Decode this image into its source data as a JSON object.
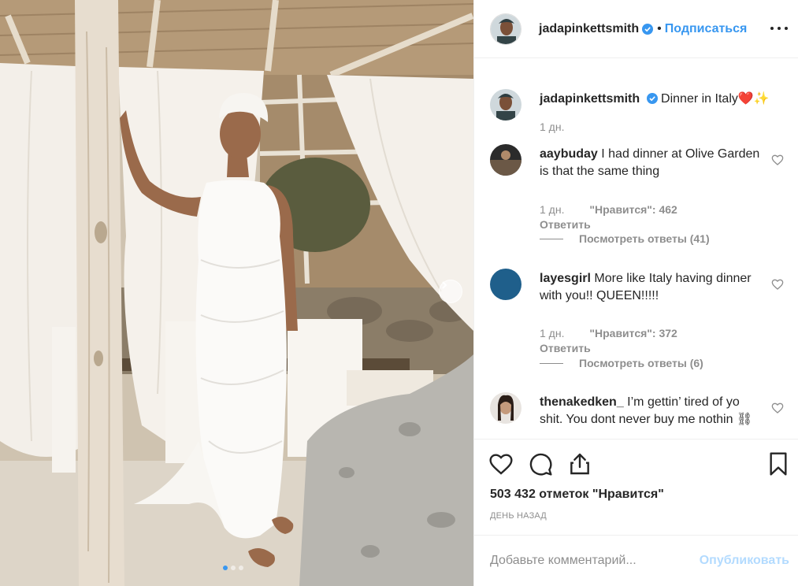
{
  "post": {
    "username": "jadapinkettsmith",
    "follow_label": "Подписаться",
    "more_icon": "more-horizontal-icon",
    "caption": {
      "username": "jadapinkettsmith",
      "text": "Dinner in Italy❤️✨",
      "time": "1 дн."
    },
    "likes_label": "503 432 отметок \"Нравится\"",
    "time_ago": "ДЕНЬ НАЗАД",
    "carousel": {
      "total": 3,
      "active": 1
    }
  },
  "comments": [
    {
      "username": "aaybuday",
      "text": "I had dinner at Olive Garden is that the same thing",
      "time": "1 дн.",
      "likes": "\"Нравится\": 462",
      "reply_label": "Ответить",
      "view_replies": "Посмотреть ответы (41)"
    },
    {
      "username": "layesgirl",
      "text": "More like Italy having dinner with you!! QUEEN!!!!!",
      "time": "1 дн.",
      "likes": "\"Нравится\": 372",
      "reply_label": "Ответить",
      "view_replies": "Посмотреть ответы (6)"
    },
    {
      "username": "thenakedken_",
      "text": "I’m gettin’ tired of yo shit. You dont never buy me nothin ⛓"
    }
  ],
  "comment_input": {
    "placeholder": "Добавьте комментарий...",
    "publish_label": "Опубликовать"
  },
  "colors": {
    "accent": "#3897f0",
    "text": "#262626",
    "muted": "#8e8e8e",
    "publish_disabled": "#b3dbff"
  }
}
